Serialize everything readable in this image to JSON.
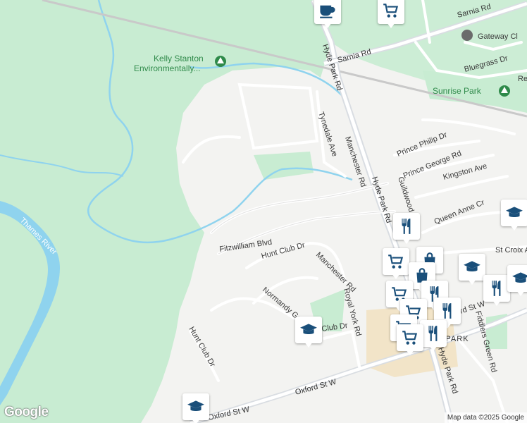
{
  "map": {
    "logo": "Google",
    "attribution": "Map data ©2025 Google"
  },
  "labels": {
    "kelly_stanton_1": "Kelly Stanton",
    "kelly_stanton_2": "Environmentally...",
    "thames_river": "Thames River",
    "sunrise_park": "Sunrise Park",
    "gateway": "Gateway Cl",
    "sarnia_rd_1": "Sarnia Rd",
    "sarnia_rd_2": "Sarnia Rd",
    "bluegrass": "Bluegrass Dr",
    "re": "Re",
    "hyde_park_rd_1": "Hyde Park Rd",
    "hyde_park_rd_2": "Hyde Park Rd",
    "hyde_park_rd_3": "Hyde Park Rd",
    "tynedale": "Tynedale Ave",
    "manchester_1": "Manchester Rd",
    "manchester_2": "Manchester Rd",
    "prince_philip": "Prince Philip Dr",
    "prince_george": "Prince George Rd",
    "kingston": "Kingston Ave",
    "guildwood": "Guildwood",
    "queen_anne": "Queen Anne Cr",
    "st_croix": "St Croix A",
    "fitzwilliam": "Fitzwilliam Blvd",
    "hunt_club_1": "Hunt Club Dr",
    "hunt_club_2": "Club Dr",
    "hunt_club_3": "Hunt Club Dr",
    "normandy": "Normandy Gardens",
    "royal_york": "Royal York Rd",
    "oxford_1": "Oxford St W",
    "oxford_2": "Oxford St W",
    "oxford_3": "Oxford St W",
    "park": "E PARK",
    "fiddlers": "Fiddlers Green Rd"
  },
  "colors": {
    "park": "#c8ecd2",
    "water": "#8fd3ee",
    "road": "#ffffff",
    "major_road": "#d9dde2",
    "poi_blue": "#1a4f7a",
    "commercial": "#f2e4c8"
  },
  "pois": [
    {
      "icon": "cafe-icon"
    },
    {
      "icon": "shopping-cart-icon"
    },
    {
      "icon": "restaurant-icon"
    },
    {
      "icon": "shopping-cart-icon"
    },
    {
      "icon": "shopping-bag-icon"
    },
    {
      "icon": "school-icon"
    },
    {
      "icon": "school-icon"
    },
    {
      "icon": "school-icon"
    },
    {
      "icon": "restaurant-icon"
    },
    {
      "icon": "shopping-cart-icon"
    },
    {
      "icon": "restaurant-icon"
    },
    {
      "icon": "school-icon"
    }
  ]
}
